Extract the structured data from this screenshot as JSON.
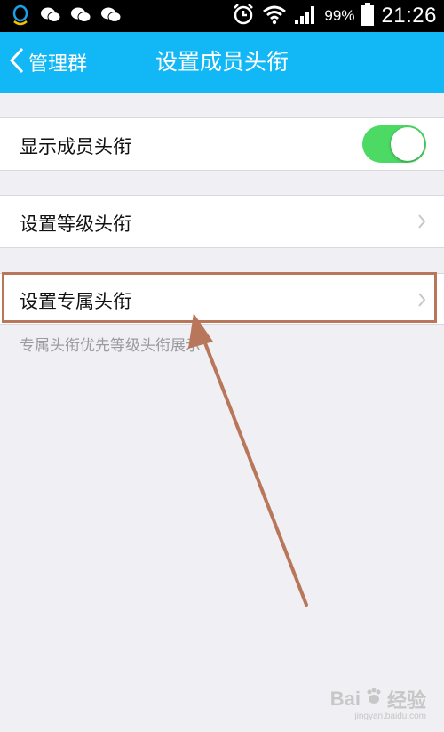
{
  "status_bar": {
    "battery_percent": "99%",
    "time": "21:26",
    "icons": [
      "qq-icon",
      "wechat-icon",
      "wechat-icon",
      "wechat-icon",
      "alarm-icon",
      "wifi-icon",
      "signal-icon",
      "battery-icon"
    ]
  },
  "header": {
    "back_label": "管理群",
    "title": "设置成员头衔"
  },
  "settings": {
    "show_titles": {
      "label": "显示成员头衔",
      "enabled": true
    },
    "level_titles": {
      "label": "设置等级头衔"
    },
    "exclusive_titles": {
      "label": "设置专属头衔"
    },
    "hint": "专属头衔优先等级头衔展示"
  },
  "annotation": {
    "color": "#b8765a"
  },
  "watermark": {
    "brand": "Bai",
    "brand_suffix": "经验",
    "url": "jingyan.baidu.com"
  },
  "colors": {
    "header_bg": "#12b7f5",
    "toggle_on": "#4cd964",
    "page_bg": "#efeff4"
  }
}
